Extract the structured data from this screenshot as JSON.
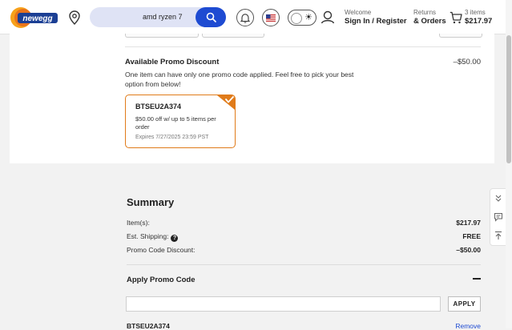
{
  "header": {
    "logo_text": "newegg",
    "search": {
      "value": "amd ryzen 7",
      "placeholder": ""
    },
    "welcome_label": "Welcome",
    "signin_label": "Sign In / Register",
    "returns_label": "Returns",
    "orders_label": "& Orders",
    "cart_count": "3 items",
    "cart_total": "$217.97"
  },
  "promo": {
    "title": "Available Promo Discount",
    "amount": "–$50.00",
    "description": "One item can have only one promo code applied. Feel free to pick your best option from below!",
    "coupon": {
      "code": "BTSEU2A374",
      "detail": "$50.00 off w/ up to 5 items per order",
      "expires": "Expires 7/27/2025 23:59 PST"
    }
  },
  "summary": {
    "title": "Summary",
    "rows": [
      {
        "label": "Item(s):",
        "value": "$217.97"
      },
      {
        "label": "Est. Shipping:",
        "value": "FREE"
      },
      {
        "label": "Promo Code Discount:",
        "value": "–$50.00"
      }
    ],
    "apply_title": "Apply Promo Code",
    "promo_input": {
      "value": "",
      "placeholder": ""
    },
    "apply_button": "APPLY",
    "applied_code": "BTSEU2A374",
    "remove_label": "Remove"
  },
  "colors": {
    "brand_orange": "#e07b1a",
    "brand_blue": "#1e4bd2",
    "search_bg": "#dfe3f5"
  },
  "icons": {
    "location": "map-pin-icon",
    "search": "search-icon",
    "bell": "bell-icon",
    "flag": "us-flag-icon",
    "theme": "sun-icon",
    "user": "user-icon",
    "cart": "cart-icon",
    "check": "checkmark-icon",
    "help": "question-circle-icon",
    "collapse": "minus-icon"
  }
}
